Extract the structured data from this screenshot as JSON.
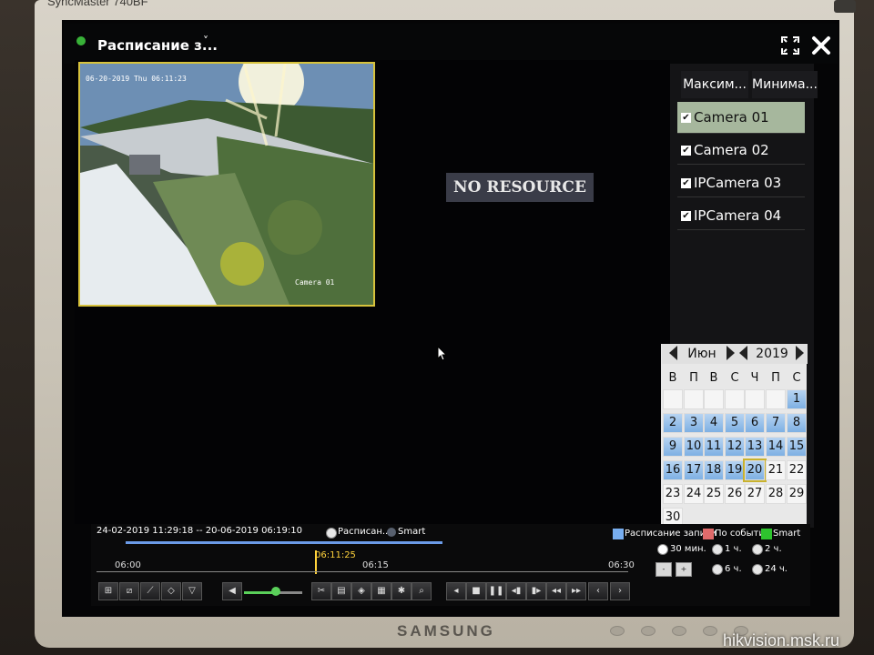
{
  "monitor": {
    "model": "SyncMaster 740BF",
    "brand": "SAMSUNG",
    "watermark": "hikvision.msk.ru"
  },
  "header": {
    "title": "Расписание з...",
    "caret": "˅"
  },
  "video": {
    "camera1_timestamp": "06-20-2019 Thu 06:11:23",
    "camera1_label": "Camera 01",
    "no_resource_text": "NO RESOURCE"
  },
  "panel": {
    "maximize_label": "Максим...",
    "minimize_label": "Минима...",
    "cameras": [
      {
        "label": "Camera 01",
        "checked": true,
        "selected": true
      },
      {
        "label": "Camera 02",
        "checked": true
      },
      {
        "label": "IPCamera 03",
        "checked": true
      },
      {
        "label": "IPCamera 04",
        "checked": true
      }
    ]
  },
  "calendar": {
    "month": "Июн",
    "year": "2019",
    "weekdays": [
      "В",
      "П",
      "В",
      "С",
      "Ч",
      "П",
      "С"
    ],
    "days": [
      "1",
      "2",
      "3",
      "4",
      "5",
      "6",
      "7",
      "8",
      "9",
      "10",
      "11",
      "12",
      "13",
      "14",
      "15",
      "16",
      "17",
      "18",
      "19",
      "20",
      "21",
      "22",
      "23",
      "24",
      "25",
      "26",
      "27",
      "28",
      "29",
      "30"
    ],
    "selected_day": "20",
    "recorded_days_through": 20
  },
  "timeline": {
    "range": "24-02-2019 11:29:18 -- 20-06-2019 06:19:10",
    "mode_schedule": "Расписан...",
    "mode_smart": "Smart",
    "current_time": "06:11:25",
    "ticks": [
      "06:00",
      "06:15",
      "06:30"
    ],
    "legend": [
      {
        "label": "Расписание записи",
        "color": "#78aef0"
      },
      {
        "label": "По событию",
        "color": "#e06b6b"
      },
      {
        "label": "Smart",
        "color": "#2ec42e"
      }
    ],
    "zoom_options": [
      "30 мин.",
      "1 ч.",
      "2 ч.",
      "6 ч.",
      "24 ч."
    ],
    "zoom_selected": "30 мин.",
    "zoom_out_label": "-",
    "zoom_in_label": "+"
  },
  "toolbar": {
    "left_icons": [
      "expand-icon",
      "crop-icon",
      "line-icon",
      "diamond-icon",
      "filter-icon"
    ],
    "audio_icon": "audio-icon",
    "volume_level": 0.55,
    "clip_icons": [
      "scissors-icon",
      "save-clip-icon",
      "tag-icon",
      "add-tag-icon",
      "settings-icon",
      "search-icon"
    ],
    "playback_buttons": [
      "◂",
      "■",
      "❚❚",
      "◂▮",
      "▮▸",
      "◂◂",
      "▸▸",
      "‹",
      "›"
    ]
  },
  "colors": {
    "accent": "#d7c23c",
    "record": "#78aef0",
    "panel_selected": "#a6b79d"
  }
}
